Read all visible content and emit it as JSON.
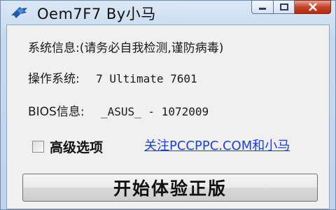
{
  "window": {
    "title": "Oem7F7 By小马",
    "icons": {
      "app": "horse-icon",
      "minimize": "minimize-icon",
      "maximize": "maximize-icon",
      "close": "close-icon"
    }
  },
  "info": {
    "system_info_label": "系统信息:(请务必自我检测,谨防病毒)",
    "os_label": "操作系统:",
    "os_value": "7 Ultimate 7601",
    "bios_label": "BIOS信息:",
    "bios_value": "_ASUS_ - 1072009"
  },
  "options": {
    "advanced_label": "高级选项",
    "advanced_checked": false,
    "follow_link": "关注PCCPPC.COM和小马"
  },
  "actions": {
    "start_label": "开始体验正版"
  }
}
